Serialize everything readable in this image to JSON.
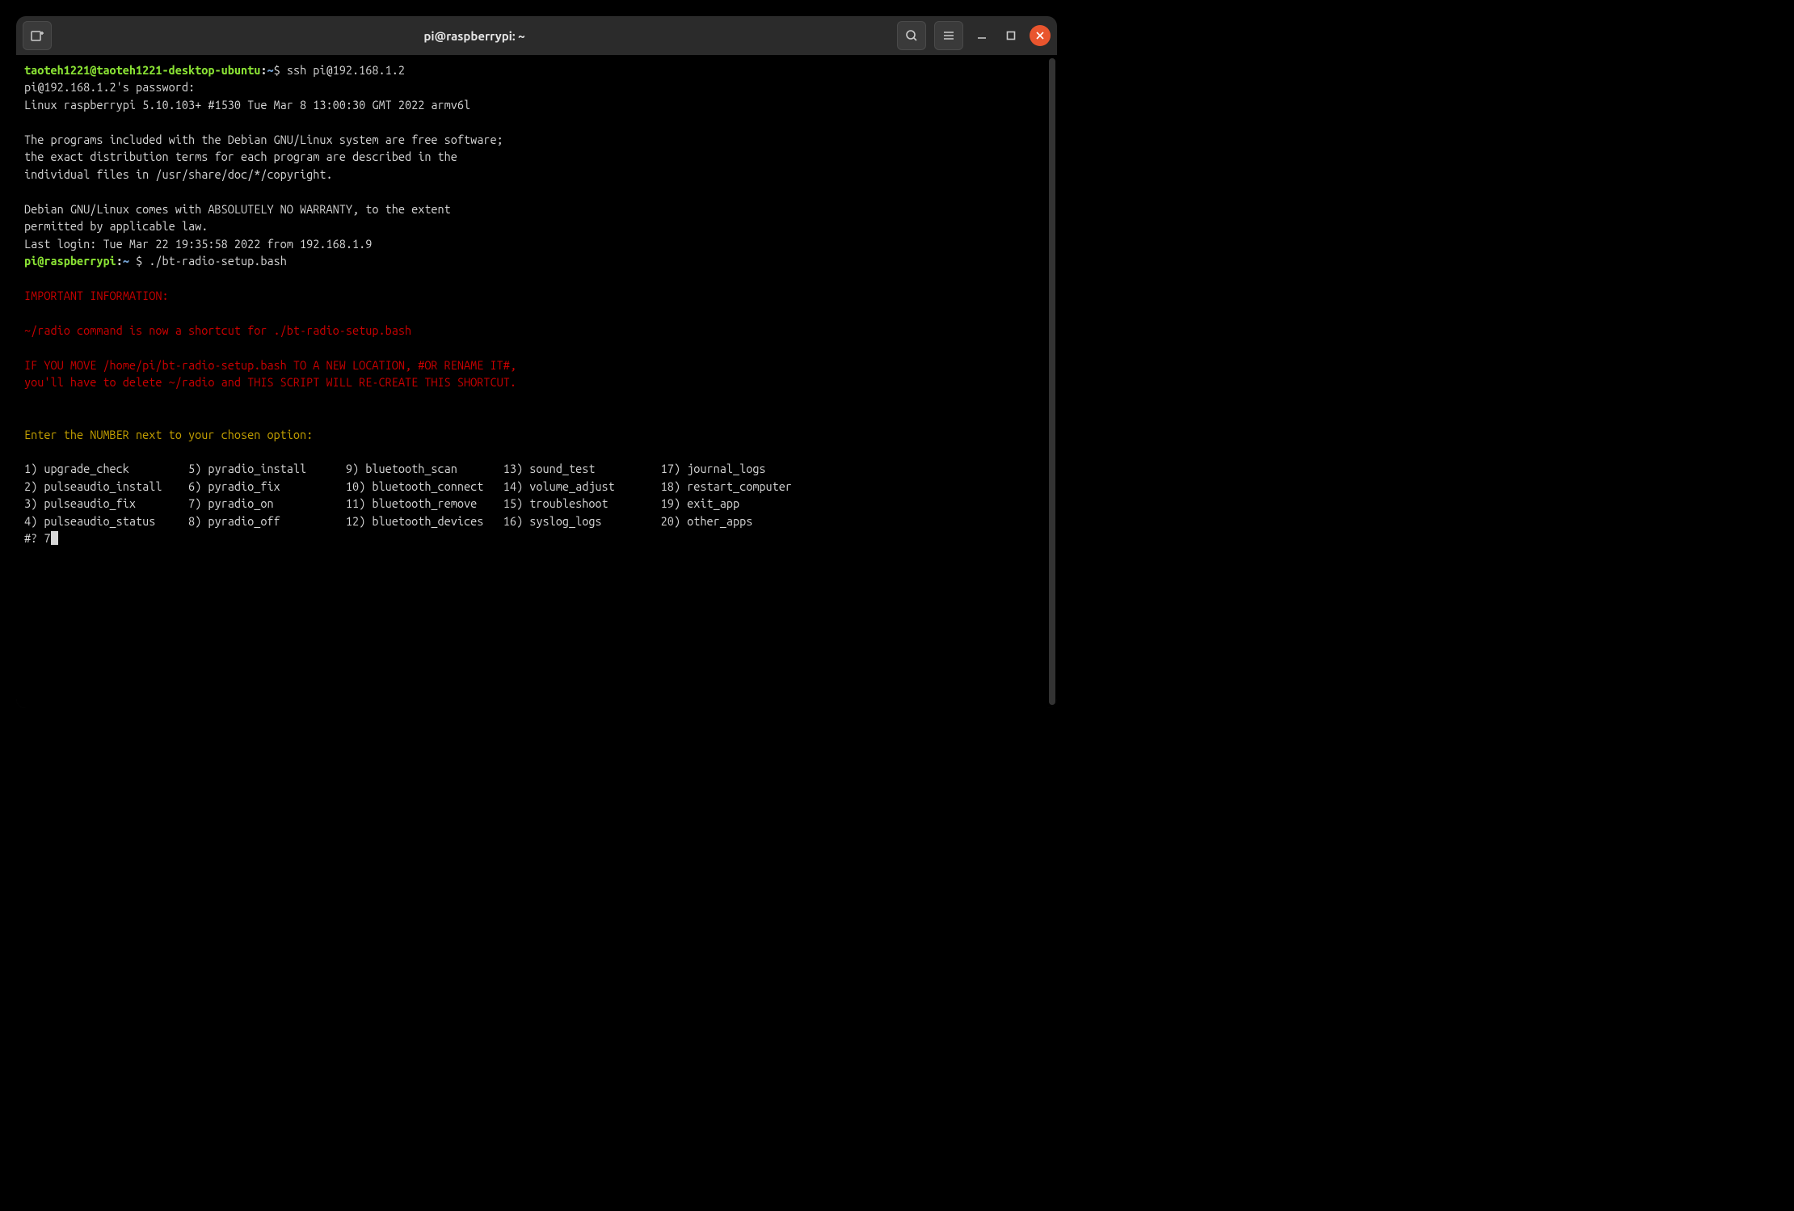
{
  "titlebar": {
    "title": "pi@raspberrypi: ~"
  },
  "colors": {
    "user_host": "#8ae234",
    "path": "#729fcf",
    "red": "#cc0000",
    "yellow": "#c4a000",
    "text": "#d6d6d6",
    "background": "#000000",
    "window_bg": "#1c1c1c",
    "titlebar_bg": "#2b2b2b",
    "close_btn": "#e9552e"
  },
  "prompt1": {
    "user_host": "taoteh1221@taoteh1221-desktop-ubuntu",
    "path": "~",
    "command": "ssh pi@192.168.1.2"
  },
  "ssh_login": {
    "password_prompt": "pi@192.168.1.2's password:",
    "kernel": "Linux raspberrypi 5.10.103+ #1530 Tue Mar 8 13:00:30 GMT 2022 armv6l",
    "motd_line1": "The programs included with the Debian GNU/Linux system are free software;",
    "motd_line2": "the exact distribution terms for each program are described in the",
    "motd_line3": "individual files in /usr/share/doc/*/copyright.",
    "motd_line4": "Debian GNU/Linux comes with ABSOLUTELY NO WARRANTY, to the extent",
    "motd_line5": "permitted by applicable law.",
    "last_login": "Last login: Tue Mar 22 19:35:58 2022 from 192.168.1.9"
  },
  "prompt2": {
    "user_host": "pi@raspberrypi",
    "path": "~ ",
    "command": "./bt-radio-setup.bash"
  },
  "script_output": {
    "header": "IMPORTANT INFORMATION:",
    "info_line1": "~/radio command is now a shortcut for ./bt-radio-setup.bash",
    "info_line2": "IF YOU MOVE /home/pi/bt-radio-setup.bash TO A NEW LOCATION, #OR RENAME IT#,",
    "info_line3": "you'll have to delete ~/radio and THIS SCRIPT WILL RE-CREATE THIS SHORTCUT.",
    "menu_prompt": "Enter the NUMBER next to your chosen option:"
  },
  "menu": {
    "columns": [
      [
        {
          "n": "1",
          "label": "upgrade_check"
        },
        {
          "n": "2",
          "label": "pulseaudio_install"
        },
        {
          "n": "3",
          "label": "pulseaudio_fix"
        },
        {
          "n": "4",
          "label": "pulseaudio_status"
        }
      ],
      [
        {
          "n": "5",
          "label": "pyradio_install"
        },
        {
          "n": "6",
          "label": "pyradio_fix"
        },
        {
          "n": "7",
          "label": "pyradio_on"
        },
        {
          "n": "8",
          "label": "pyradio_off"
        }
      ],
      [
        {
          "n": "9",
          "label": "bluetooth_scan"
        },
        {
          "n": "10",
          "label": "bluetooth_connect"
        },
        {
          "n": "11",
          "label": "bluetooth_remove"
        },
        {
          "n": "12",
          "label": "bluetooth_devices"
        }
      ],
      [
        {
          "n": "13",
          "label": "sound_test"
        },
        {
          "n": "14",
          "label": "volume_adjust"
        },
        {
          "n": "15",
          "label": "troubleshoot"
        },
        {
          "n": "16",
          "label": "syslog_logs"
        }
      ],
      [
        {
          "n": "17",
          "label": "journal_logs"
        },
        {
          "n": "18",
          "label": "restart_computer"
        },
        {
          "n": "19",
          "label": "exit_app"
        },
        {
          "n": "20",
          "label": "other_apps"
        }
      ]
    ]
  },
  "input": {
    "prompt": "#?",
    "value": "7"
  }
}
